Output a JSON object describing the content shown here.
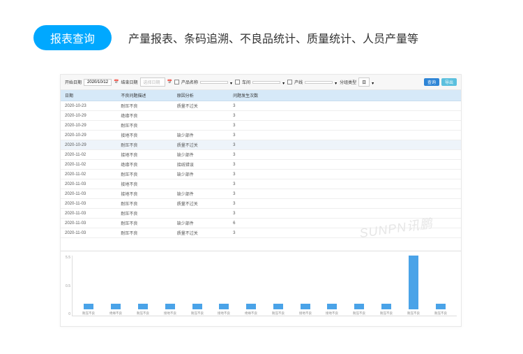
{
  "header": {
    "pill": "报表查询",
    "desc": "产量报表、条码追溯、不良品统计、质量统计、人员产量等"
  },
  "filters": {
    "start_label": "开始日期",
    "start_value": "2020/10/12",
    "end_label": "结束日期",
    "end_placeholder": "选择日期",
    "product_label": "产品名称",
    "workshop_label": "车间",
    "line_label": "产线",
    "group_label": "分组类型",
    "group_value": "日",
    "btn_query": "查询",
    "btn_export": "导出"
  },
  "table": {
    "headers": [
      "日期",
      "不良问题描述",
      "原因分析",
      "问题发生次数"
    ],
    "rows": [
      {
        "d": "2020-10-23",
        "p": "耐压不良",
        "r": "质量不过关",
        "c": 3,
        "sel": false
      },
      {
        "d": "2020-10-29",
        "p": "绝缘不良",
        "r": "",
        "c": 3,
        "sel": false
      },
      {
        "d": "2020-10-29",
        "p": "耐压不良",
        "r": "",
        "c": 3,
        "sel": false
      },
      {
        "d": "2020-10-29",
        "p": "接地不良",
        "r": "缺少部件",
        "c": 3,
        "sel": false
      },
      {
        "d": "2020-10-29",
        "p": "耐压不良",
        "r": "质量不过关",
        "c": 3,
        "sel": true
      },
      {
        "d": "2020-11-02",
        "p": "接地不良",
        "r": "缺少部件",
        "c": 3,
        "sel": false
      },
      {
        "d": "2020-11-02",
        "p": "绝缘不良",
        "r": "接线错误",
        "c": 3,
        "sel": false
      },
      {
        "d": "2020-11-02",
        "p": "耐压不良",
        "r": "缺少部件",
        "c": 3,
        "sel": false
      },
      {
        "d": "2020-11-03",
        "p": "接地不良",
        "r": "",
        "c": 3,
        "sel": false
      },
      {
        "d": "2020-11-03",
        "p": "接地不良",
        "r": "缺少部件",
        "c": 3,
        "sel": false
      },
      {
        "d": "2020-11-03",
        "p": "耐压不良",
        "r": "质量不过关",
        "c": 3,
        "sel": false
      },
      {
        "d": "2020-11-03",
        "p": "耐压不良",
        "r": "",
        "c": 3,
        "sel": false
      },
      {
        "d": "2020-11-03",
        "p": "耐压不良",
        "r": "缺少部件",
        "c": 6,
        "sel": false
      },
      {
        "d": "2020-11-03",
        "p": "耐压不良",
        "r": "质量不过关",
        "c": 3,
        "sel": false
      }
    ]
  },
  "chart_data": {
    "type": "bar",
    "title": "",
    "ylabel": "",
    "xlabel": "",
    "ylim": [
      0,
      5.5
    ],
    "yticks": [
      0,
      0.5,
      5.5
    ],
    "categories": [
      "耐压不良",
      "绝缘不良",
      "耐压不良",
      "接地不良",
      "耐压不良",
      "接地不良",
      "绝缘不良",
      "耐压不良",
      "接地不良",
      "接地不良",
      "耐压不良",
      "耐压不良",
      "耐压不良",
      "耐压不良"
    ],
    "values": [
      0.5,
      0.5,
      0.5,
      0.5,
      0.5,
      0.5,
      0.5,
      0.5,
      0.5,
      0.5,
      0.5,
      0.5,
      5.2,
      0.5
    ]
  },
  "watermark": "SUNPN讯鹏"
}
